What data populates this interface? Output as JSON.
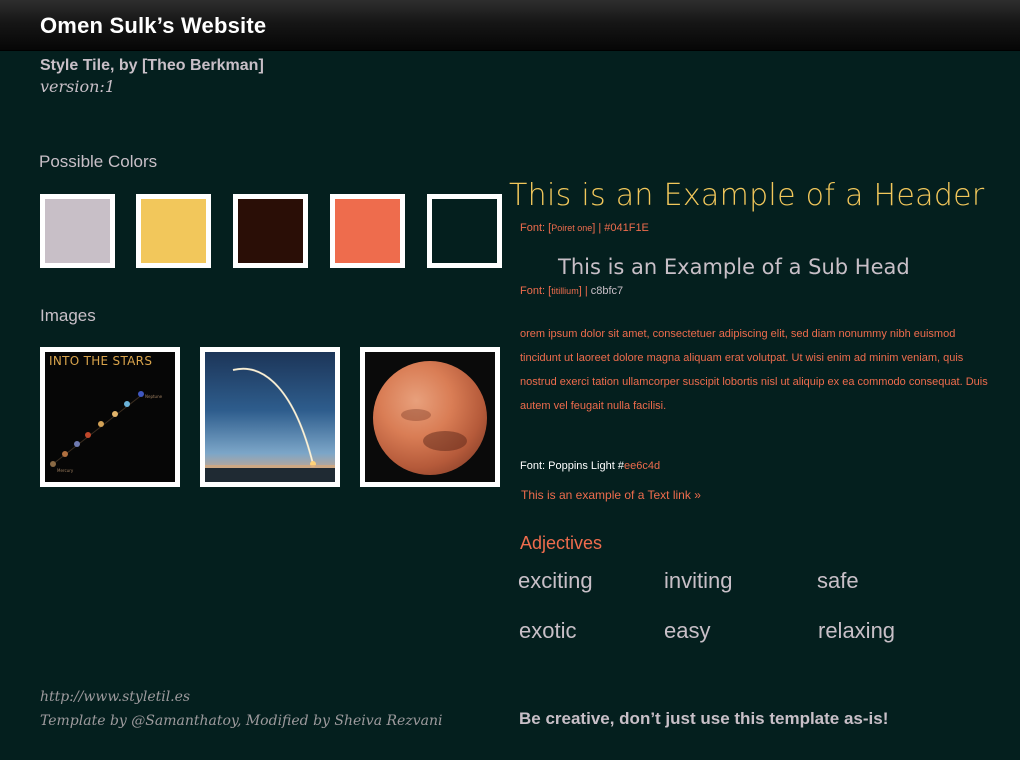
{
  "site": {
    "title": "Omen Sulk’s Website",
    "tile_by": "Style Tile, by [Theo Berkman]",
    "version": "version:1"
  },
  "colors": {
    "label": "Possible Colors",
    "swatches": [
      "#c8bfc7",
      "#f2c75b",
      "#2a0e06",
      "#ee6c4d",
      "#041f1e"
    ]
  },
  "images": {
    "label": "Images",
    "items": [
      {
        "name": "into-the-stars",
        "caption": "INTO THE STARS"
      },
      {
        "name": "rocket-launch",
        "caption": ""
      },
      {
        "name": "mars-planet",
        "caption": ""
      }
    ]
  },
  "typography": {
    "header_example": "This is an Example of a Header",
    "header_font_prefix": "Font: [",
    "header_font_name": "Poiret one",
    "header_font_sep": "]  |  ",
    "header_font_color": "#041F1E",
    "subhead_example": "This is an Example of a Sub Head",
    "subhead_font_prefix": "Font: [",
    "subhead_font_name": "titillium",
    "subhead_font_sep": "]  |  ",
    "subhead_font_color": "c8bfc7",
    "body_text": "orem ipsum dolor sit amet, consectetuer adipiscing elit, sed diam nonummy nibh euismod tincidunt ut laoreet dolore magna aliquam erat volutpat. Ut wisi enim ad minim veniam, quis nostrud exerci tation ullamcorper suscipit lobortis nisl ut aliquip ex ea commodo consequat. Duis autem vel feugait nulla facilisi.",
    "body_font_prefix": "Font: Poppins Light #",
    "body_font_color": "ee6c4d",
    "text_link": "This is an example of a Text link »"
  },
  "adjectives": {
    "title": "Adjectives",
    "words": [
      "exciting",
      "inviting",
      "safe",
      "exotic",
      "easy",
      "relaxing"
    ]
  },
  "footer": {
    "url": "http://www.styletil.es",
    "credit": "Template by @Samanthatoy, Modified by Sheiva Rezvani",
    "tagline": "Be creative, don’t just use this template as-is!"
  }
}
